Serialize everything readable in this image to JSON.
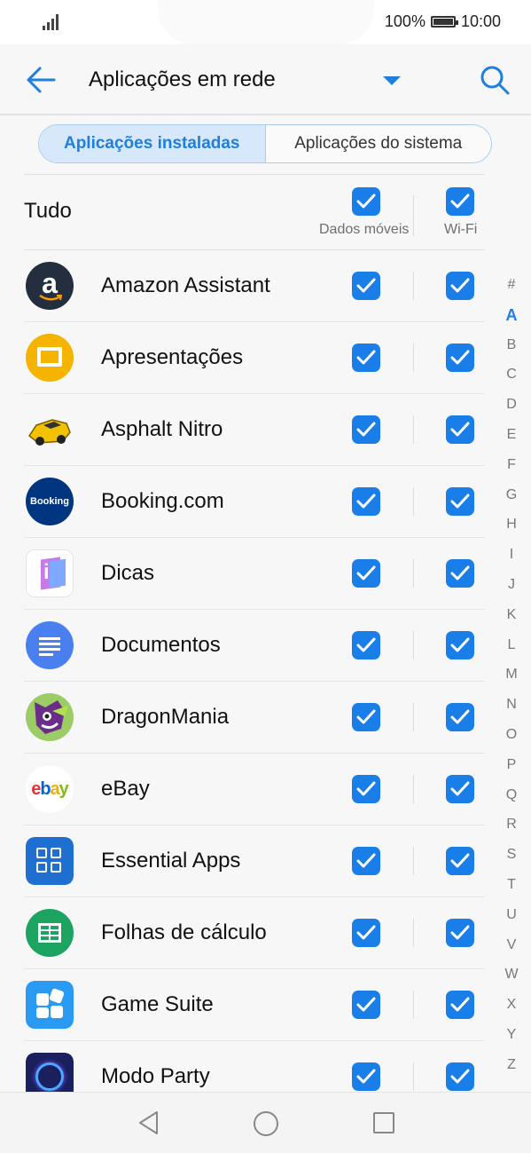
{
  "status": {
    "battery_pct": "100%",
    "time": "10:00"
  },
  "appbar": {
    "title": "Aplicações em rede"
  },
  "tabs": [
    {
      "label": "Aplicações instaladas",
      "active": true
    },
    {
      "label": "Aplicações do sistema",
      "active": false
    }
  ],
  "header": {
    "all_label": "Tudo",
    "col_mobile": "Dados móveis",
    "col_wifi": "Wi-Fi"
  },
  "apps": [
    {
      "name": "Amazon Assistant",
      "icon": "amazon-icon",
      "mobile": true,
      "wifi": true
    },
    {
      "name": "Apresentações",
      "icon": "slides-icon",
      "mobile": true,
      "wifi": true
    },
    {
      "name": "Asphalt Nitro",
      "icon": "race-car-icon",
      "mobile": true,
      "wifi": true
    },
    {
      "name": "Booking.com",
      "icon": "booking-icon",
      "mobile": true,
      "wifi": true
    },
    {
      "name": "Dicas",
      "icon": "tips-icon",
      "mobile": true,
      "wifi": true
    },
    {
      "name": "Documentos",
      "icon": "docs-icon",
      "mobile": true,
      "wifi": true
    },
    {
      "name": "DragonMania",
      "icon": "dragon-icon",
      "mobile": true,
      "wifi": true
    },
    {
      "name": "eBay",
      "icon": "ebay-icon",
      "mobile": true,
      "wifi": true
    },
    {
      "name": "Essential Apps",
      "icon": "grid-apps-icon",
      "mobile": true,
      "wifi": true
    },
    {
      "name": "Folhas de cálculo",
      "icon": "sheets-icon",
      "mobile": true,
      "wifi": true
    },
    {
      "name": "Game Suite",
      "icon": "puzzle-icon",
      "mobile": true,
      "wifi": true
    },
    {
      "name": "Modo Party",
      "icon": "party-ring-icon",
      "mobile": true,
      "wifi": true
    }
  ],
  "icon_text": {
    "booking": "Booking",
    "ebay_e": "e",
    "ebay_b": "b",
    "ebay_a": "a",
    "ebay_y": "y",
    "amazon_a": "a",
    "dicas_i": "i"
  },
  "alphabet": [
    "#",
    "A",
    "B",
    "C",
    "D",
    "E",
    "F",
    "G",
    "H",
    "I",
    "J",
    "K",
    "L",
    "M",
    "N",
    "O",
    "P",
    "Q",
    "R",
    "S",
    "T",
    "U",
    "V",
    "W",
    "X",
    "Y",
    "Z"
  ],
  "alphabet_selected": "A",
  "colors": {
    "accent": "#1a7ee8",
    "tab_active_bg": "#d6e8fa"
  }
}
